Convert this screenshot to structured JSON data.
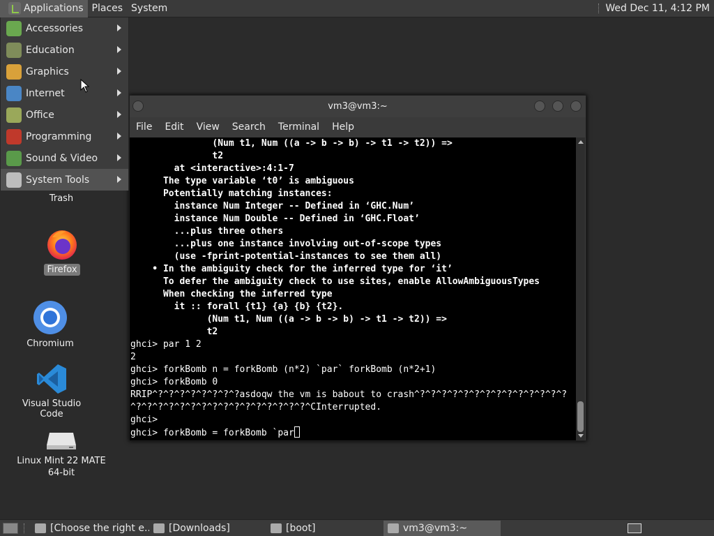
{
  "top_panel": {
    "menus": [
      "Applications",
      "Places",
      "System"
    ],
    "clock": "Wed Dec 11,  4:12 PM"
  },
  "app_menu": {
    "items": [
      {
        "label": "Accessories",
        "icon": "accessories-icon",
        "color": "#6aa84f"
      },
      {
        "label": "Education",
        "icon": "education-icon",
        "color": "#7f8c5a"
      },
      {
        "label": "Graphics",
        "icon": "graphics-icon",
        "color": "#d9a13a"
      },
      {
        "label": "Internet",
        "icon": "internet-icon",
        "color": "#4a86c5"
      },
      {
        "label": "Office",
        "icon": "office-icon",
        "color": "#9aa85a"
      },
      {
        "label": "Programming",
        "icon": "programming-icon",
        "color": "#c0392b"
      },
      {
        "label": "Sound & Video",
        "icon": "sound-video-icon",
        "color": "#5a9a4a"
      },
      {
        "label": "System Tools",
        "icon": "system-tools-icon",
        "color": "#bdbdbd"
      }
    ]
  },
  "desktop": {
    "icons": [
      {
        "label": "Trash",
        "icon": "trash-icon"
      },
      {
        "label": "Firefox",
        "icon": "firefox-icon"
      },
      {
        "label": "Chromium",
        "icon": "chromium-icon"
      },
      {
        "label": "Visual Studio Code",
        "icon": "vscode-icon"
      },
      {
        "label": "Linux Mint 22 MATE",
        "label2": "64-bit",
        "icon": "drive-icon"
      }
    ]
  },
  "terminal": {
    "title": "vm3@vm3:~",
    "menu": [
      "File",
      "Edit",
      "View",
      "Search",
      "Terminal",
      "Help"
    ],
    "lines": [
      {
        "text": "               (Num t1, Num ((a -> b -> b) -> t1 -> t2)) =>",
        "bold": true
      },
      {
        "text": "               t2",
        "bold": true
      },
      {
        "text": "        at <interactive>:4:1-7",
        "bold": true
      },
      {
        "text": "      The type variable ‘t0’ is ambiguous",
        "bold": true
      },
      {
        "text": "      Potentially matching instances:",
        "bold": true
      },
      {
        "text": "        instance Num Integer -- Defined in ‘GHC.Num’",
        "bold": true
      },
      {
        "text": "        instance Num Double -- Defined in ‘GHC.Float’",
        "bold": true
      },
      {
        "text": "        ...plus three others",
        "bold": true
      },
      {
        "text": "        ...plus one instance involving out-of-scope types",
        "bold": true
      },
      {
        "text": "        (use -fprint-potential-instances to see them all)",
        "bold": true
      },
      {
        "text": "    • In the ambiguity check for the inferred type for ‘it’",
        "bold": true
      },
      {
        "text": "      To defer the ambiguity check to use sites, enable AllowAmbiguousTypes",
        "bold": true
      },
      {
        "text": "      When checking the inferred type",
        "bold": true
      },
      {
        "text": "        it :: forall {t1} {a} {b} {t2}.",
        "bold": true
      },
      {
        "text": "              (Num t1, Num ((a -> b -> b) -> t1 -> t2)) =>",
        "bold": true
      },
      {
        "text": "              t2",
        "bold": true
      },
      {
        "text": "ghci> par 1 2",
        "bold": false
      },
      {
        "text": "2",
        "bold": false
      },
      {
        "text": "ghci> forkBomb n = forkBomb (n*2) `par` forkBomb (n*2+1)",
        "bold": false
      },
      {
        "text": "ghci> forkBomb 0",
        "bold": false
      },
      {
        "text": "RRIP^?^?^?^?^?^?^?^?asdoqw the vm is babout to crash^?^?^?^?^?^?^?^?^?^?^?^?^?^?",
        "bold": false
      },
      {
        "text": "^?^?^?^?^?^?^?^?^?^?^?^?^?^?^?^?^CInterrupted.",
        "bold": false
      },
      {
        "text": "ghci>",
        "bold": false
      },
      {
        "text": "ghci> forkBomb = forkBomb `par",
        "bold": false
      }
    ]
  },
  "taskbar": {
    "items": [
      {
        "label": "[Choose the right e...",
        "icon": "firefox-icon",
        "active": false
      },
      {
        "label": "[Downloads]",
        "icon": "folder-icon",
        "active": false
      },
      {
        "label": "[boot]",
        "icon": "folder-icon",
        "active": false
      },
      {
        "label": "vm3@vm3:~",
        "icon": "terminal-icon",
        "active": true
      }
    ]
  }
}
